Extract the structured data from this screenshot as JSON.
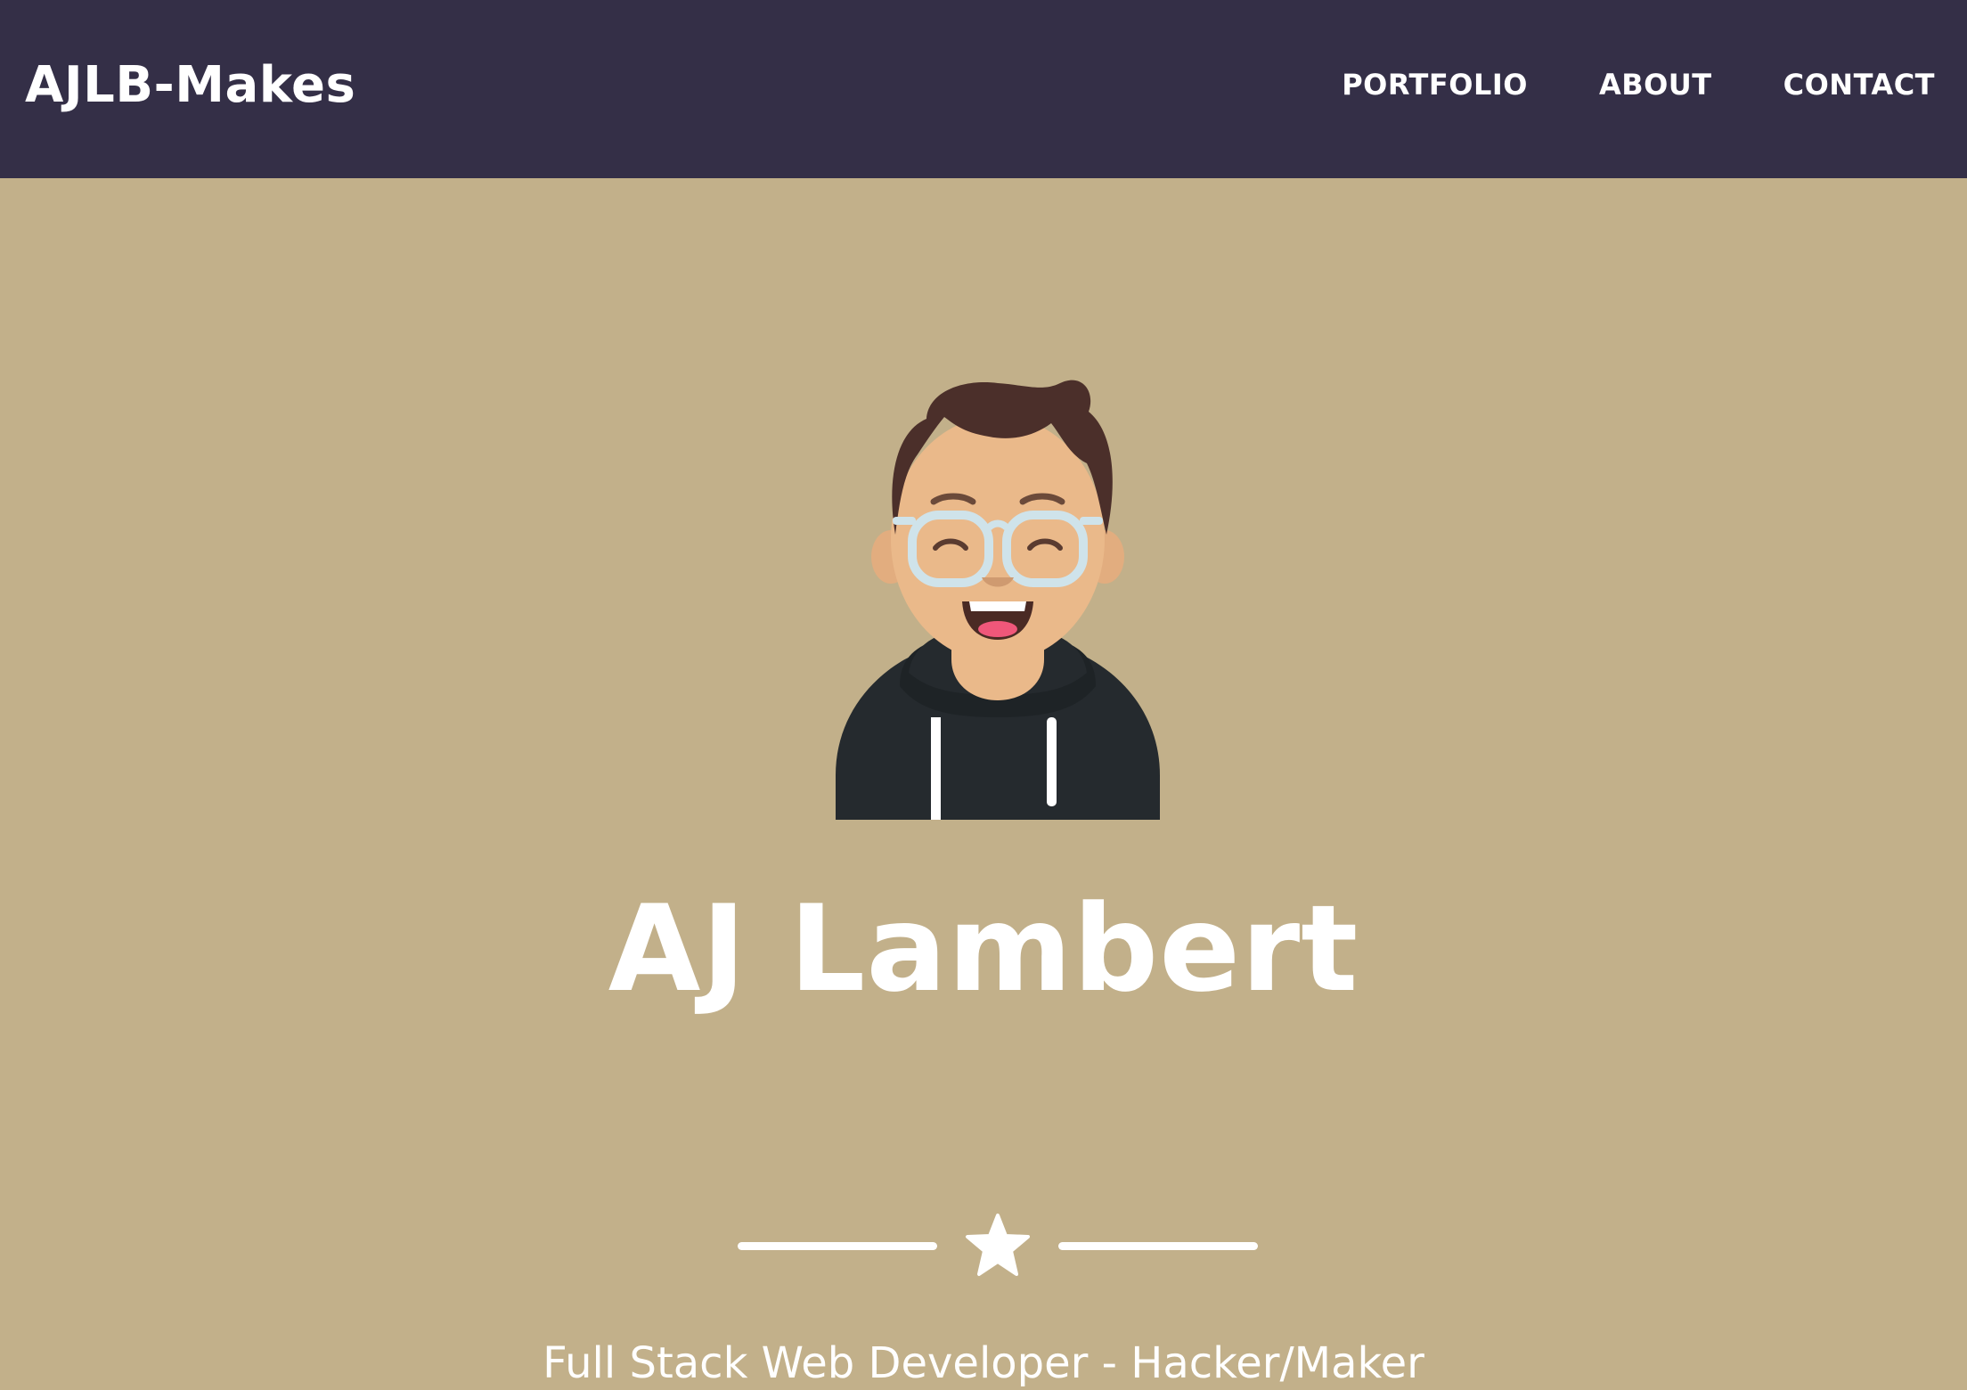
{
  "navbar": {
    "brand": "AJLB-Makes",
    "links": [
      {
        "label": "PORTFOLIO"
      },
      {
        "label": "ABOUT"
      },
      {
        "label": "CONTACT"
      }
    ]
  },
  "hero": {
    "name": "AJ Lambert",
    "subtitle": "Full Stack Web Developer - Hacker/Maker",
    "divider_icon": "star-icon",
    "avatar_icon": "developer-avatar-icon"
  },
  "colors": {
    "navbar_bg": "#342f47",
    "hero_bg": "#c2b08a",
    "text": "#ffffff"
  }
}
